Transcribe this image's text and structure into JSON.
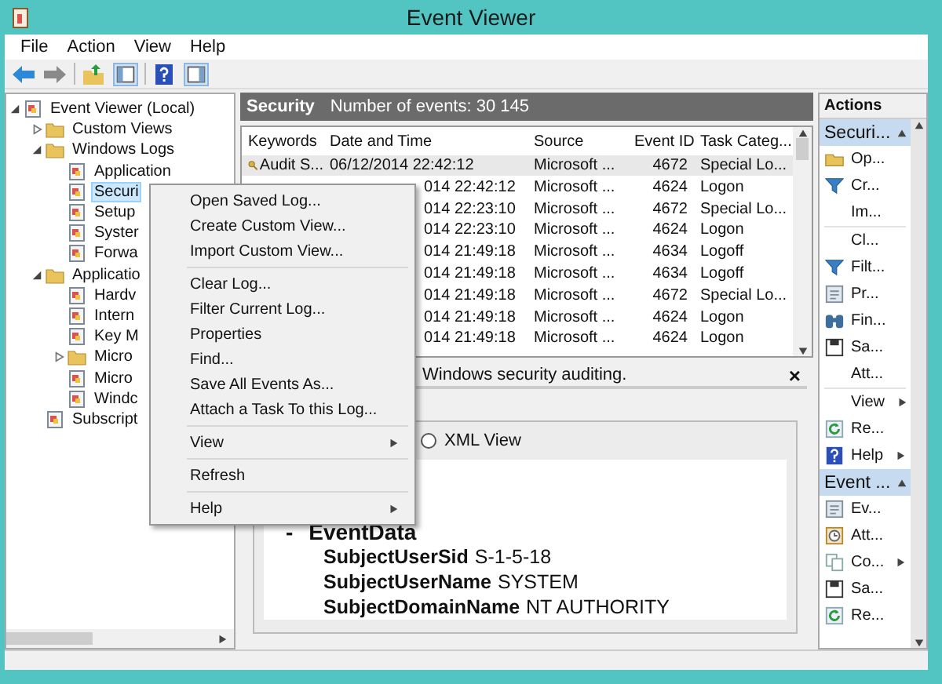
{
  "window": {
    "title": "Event Viewer"
  },
  "menu_bar": [
    "File",
    "Action",
    "View",
    "Help"
  ],
  "tree": [
    {
      "label": "Event Viewer (Local)",
      "selected": false,
      "expanded": true,
      "children": [
        {
          "label": "Custom Views",
          "selected": false,
          "expanded": false
        },
        {
          "label": "Windows Logs",
          "selected": false,
          "expanded": true,
          "children": [
            {
              "label": "Application",
              "selected": false
            },
            {
              "label": "Securi",
              "selected": true
            },
            {
              "label": "Setup",
              "selected": false
            },
            {
              "label": "Syster",
              "selected": false
            },
            {
              "label": "Forwa",
              "selected": false
            }
          ]
        },
        {
          "label": "Applicatio",
          "selected": false,
          "expanded": true,
          "children": [
            {
              "label": "Hardv",
              "selected": false
            },
            {
              "label": "Intern",
              "selected": false
            },
            {
              "label": "Key M",
              "selected": false
            },
            {
              "label": "Micro",
              "selected": false,
              "expanded": false
            },
            {
              "label": "Micro",
              "selected": false
            },
            {
              "label": "Windc",
              "selected": false
            }
          ]
        },
        {
          "label": "Subscript",
          "selected": false
        }
      ]
    }
  ],
  "log_header": {
    "name": "Security",
    "count": "Number of events: 30 145"
  },
  "table": {
    "columns": [
      "Keywords",
      "Date and Time",
      "Source",
      "Event ID",
      "Task Categ..."
    ],
    "rows": [
      {
        "covered": false,
        "keywords": "Audit S...",
        "date": "06/12/2014 22:42:12",
        "source": "Microsoft ...",
        "event_id": "4672",
        "task": "Special Lo..."
      },
      {
        "covered": true,
        "date": "014 22:42:12",
        "source": "Microsoft ...",
        "event_id": "4624",
        "task": "Logon"
      },
      {
        "covered": true,
        "date": "014 22:23:10",
        "source": "Microsoft ...",
        "event_id": "4672",
        "task": "Special Lo..."
      },
      {
        "covered": true,
        "date": "014 22:23:10",
        "source": "Microsoft ...",
        "event_id": "4624",
        "task": "Logon"
      },
      {
        "covered": true,
        "date": "014 21:49:18",
        "source": "Microsoft ...",
        "event_id": "4634",
        "task": "Logoff"
      },
      {
        "covered": true,
        "date": "014 21:49:18",
        "source": "Microsoft ...",
        "event_id": "4634",
        "task": "Logoff"
      },
      {
        "covered": true,
        "date": "014 21:49:18",
        "source": "Microsoft ...",
        "event_id": "4672",
        "task": "Special Lo..."
      },
      {
        "covered": true,
        "date": "014 21:49:18",
        "source": "Microsoft ...",
        "event_id": "4624",
        "task": "Logon"
      },
      {
        "covered": true,
        "date": "014 21:49:18",
        "source": "Microsoft ...",
        "event_id": "4624",
        "task": "Logon"
      }
    ]
  },
  "details": {
    "header": "Windows security auditing.",
    "close": "×",
    "xml_view": {
      "label": "XML View",
      "selected": false
    },
    "section": {
      "toggle": "-",
      "title": "EventData"
    },
    "fields": [
      {
        "name": "SubjectUserSid",
        "value": "S-1-5-18"
      },
      {
        "name": "SubjectUserName",
        "value": "SYSTEM"
      },
      {
        "name": "SubjectDomainName",
        "value": "NT AUTHORITY"
      }
    ]
  },
  "context_menu": [
    [
      {
        "label": "Open Saved Log...",
        "submenu": false
      },
      {
        "label": "Create Custom View...",
        "submenu": false
      },
      {
        "label": "Import Custom View...",
        "submenu": false
      }
    ],
    [
      {
        "label": "Clear Log...",
        "submenu": false
      },
      {
        "label": "Filter Current Log...",
        "submenu": false
      },
      {
        "label": "Properties",
        "submenu": false
      },
      {
        "label": "Find...",
        "submenu": false
      },
      {
        "label": "Save All Events As...",
        "submenu": false
      },
      {
        "label": "Attach a Task To this Log...",
        "submenu": false
      }
    ],
    [
      {
        "label": "View",
        "submenu": true
      }
    ],
    [
      {
        "label": "Refresh",
        "submenu": false
      }
    ],
    [
      {
        "label": "Help",
        "submenu": true
      }
    ]
  ],
  "actions": {
    "title": "Actions",
    "sections": [
      {
        "title": "Securi...",
        "expanded": true,
        "groups": [
          [
            {
              "label": "Op...",
              "submenu": false
            },
            {
              "label": "Cr...",
              "submenu": false
            },
            {
              "label": "Im...",
              "submenu": false
            }
          ],
          [
            {
              "label": "Cl...",
              "submenu": false
            },
            {
              "label": "Filt...",
              "submenu": false
            },
            {
              "label": "Pr...",
              "submenu": false
            },
            {
              "label": "Fin...",
              "submenu": false
            },
            {
              "label": "Sa...",
              "submenu": false
            },
            {
              "label": "Att...",
              "submenu": false
            }
          ],
          [
            {
              "label": "View",
              "submenu": true
            },
            {
              "label": "Re...",
              "submenu": false
            },
            {
              "label": "Help",
              "submenu": true
            }
          ]
        ]
      },
      {
        "title": "Event ...",
        "expanded": true,
        "groups": [
          [
            {
              "label": "Ev...",
              "submenu": false
            },
            {
              "label": "Att...",
              "submenu": false
            },
            {
              "label": "Co...",
              "submenu": true
            },
            {
              "label": "Sa...",
              "submenu": false
            },
            {
              "label": "Re...",
              "submenu": false
            }
          ]
        ]
      }
    ]
  }
}
